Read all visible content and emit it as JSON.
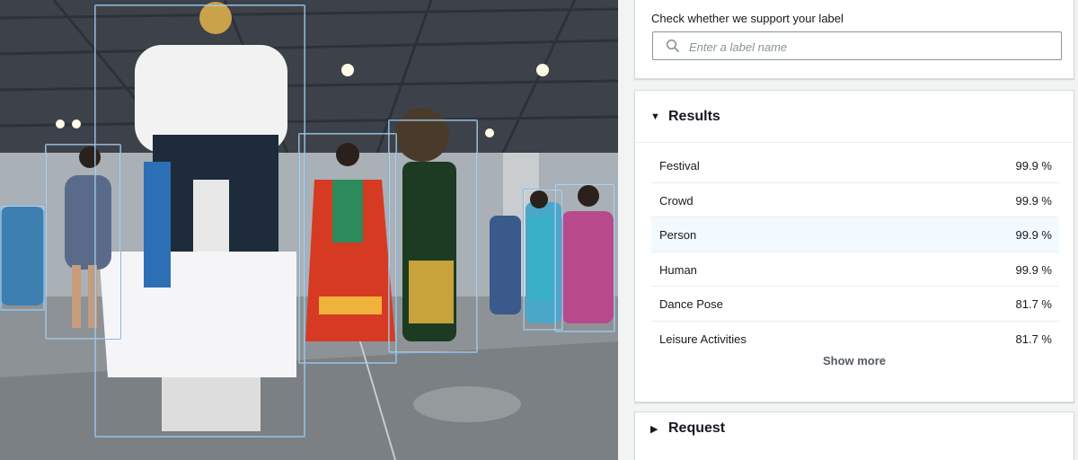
{
  "search": {
    "title": "Check whether we support your label",
    "placeholder": "Enter a label name"
  },
  "results": {
    "header": "Results",
    "rows": [
      {
        "label": "Festival",
        "value": "99.9 %"
      },
      {
        "label": "Crowd",
        "value": "99.9 %"
      },
      {
        "label": "Person",
        "value": "99.9 %"
      },
      {
        "label": "Human",
        "value": "99.9 %"
      },
      {
        "label": "Dance Pose",
        "value": "81.7 %"
      },
      {
        "label": "Leisure Activities",
        "value": "81.7 %"
      }
    ],
    "show_more": "Show more"
  },
  "request": {
    "header": "Request"
  },
  "colors": {
    "bbox": "#7fb8e8",
    "highlight_row": "#f1faff",
    "border": "#d5dbdb"
  }
}
